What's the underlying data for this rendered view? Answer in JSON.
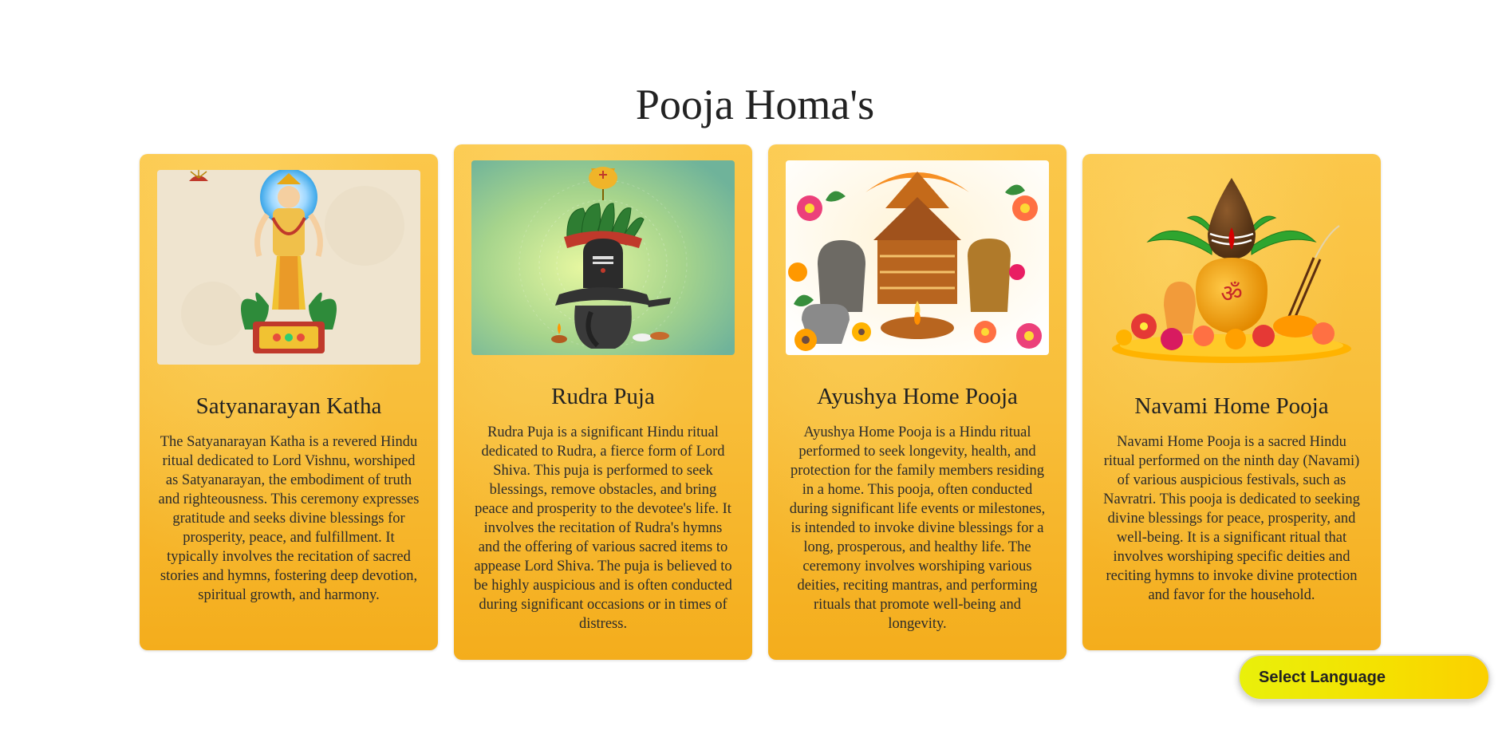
{
  "section": {
    "title": "Pooja Homa's"
  },
  "cards": [
    {
      "title": "Satyanarayan Katha",
      "description": "The Satyanarayan Katha is a revered Hindu ritual dedicated to Lord Vishnu, worshiped as Satyanarayan, the embodiment of truth and righteousness. This ceremony expresses gratitude and seeks divine blessings for prosperity, peace, and fulfillment. It typically involves the recitation of sacred stories and hymns, fostering deep devotion, spiritual growth, and harmony."
    },
    {
      "title": "Rudra Puja",
      "description": "Rudra Puja is a significant Hindu ritual dedicated to Rudra, a fierce form of Lord Shiva. This puja is performed to seek blessings, remove obstacles, and bring peace and prosperity to the devotee's life. It involves the recitation of Rudra's hymns and the offering of various sacred items to appease Lord Shiva. The puja is believed to be highly auspicious and is often conducted during significant occasions or in times of distress."
    },
    {
      "title": "Ayushya Home Pooja",
      "description": "Ayushya Home Pooja is a Hindu ritual performed to seek longevity, health, and protection for the family members residing in a home. This pooja, often conducted during significant life events or milestones, is intended to invoke divine blessings for a long, prosperous, and healthy life. The ceremony involves worshiping various deities, reciting mantras, and performing rituals that promote well-being and longevity."
    },
    {
      "title": "Navami Home Pooja",
      "description": "Navami Home Pooja is a sacred Hindu ritual performed on the ninth day (Navami) of various auspicious festivals, such as Navratri. This pooja is dedicated to seeking divine blessings for peace, prosperity, and well-being. It is a significant ritual that involves worshiping specific deities and reciting hymns to invoke divine protection and favor for the household."
    }
  ],
  "language_widget": {
    "label": "Select Language"
  },
  "colors": {
    "card_top": "#fbc74a",
    "card_bottom": "#f4ad1c",
    "button_yellow": "#f5e000"
  }
}
